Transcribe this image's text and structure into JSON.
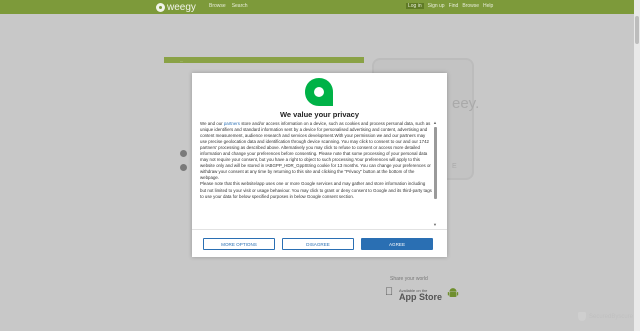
{
  "header": {
    "logo_text": "weegy",
    "nav": [
      "Browse",
      "Search"
    ],
    "right_links": [
      "Log in",
      "Sign up",
      "Find",
      "Browse",
      "Help"
    ]
  },
  "background": {
    "card_title": "...",
    "phone_text": "eey.",
    "phone_letter": "E",
    "share_label": "Share your world",
    "appstore_small": "Available on the",
    "appstore_big": "App Store",
    "secured_label": "SecuredByscure"
  },
  "dialog": {
    "title": "We value your privacy",
    "body_lead": "We and our",
    "partners_link": "partners",
    "body_rest": "store and/or access information on a device, such as cookies and process personal data, such as unique identifiers and standard information sent by a device for personalised advertising and content, advertising and content measurement, audience research and services development.With your permission we and our partners may use precise geolocation data and identification through device scanning. You may click to consent to our and our 1742 partners' processing as described above. Alternatively you may click to refuse to consent or access more detailed information and change your preferences before consenting. Please note that some processing of your personal data may not require your consent, but you have a right to object to such processing.Your preferences will apply to this website only and will be stored in IABGPP_HDR_GppString cookie for 13 months. You can change your preferences or withdraw your consent at any time by returning to this site and clicking the \"Privacy\" button at the bottom of the webpage.",
    "body_second": "Please note that this website/app uses one or more Google services and may gather and store information including but not limited to your visit or usage behaviour. You may click to grant or deny consent to Google and its third-party tags to use your data for below specified purposes in below Google consent section.",
    "more_options": "MORE OPTIONS",
    "disagree": "DISAGREE",
    "agree": "AGREE"
  },
  "colors": {
    "brand_green": "#7d9a3a",
    "accent_blue": "#2a6fb3",
    "logo_green": "#00b247"
  },
  "icons": [
    "weegy-logo-icon",
    "consent-logo-icon",
    "apple-icon",
    "android-icon",
    "shield-icon"
  ]
}
